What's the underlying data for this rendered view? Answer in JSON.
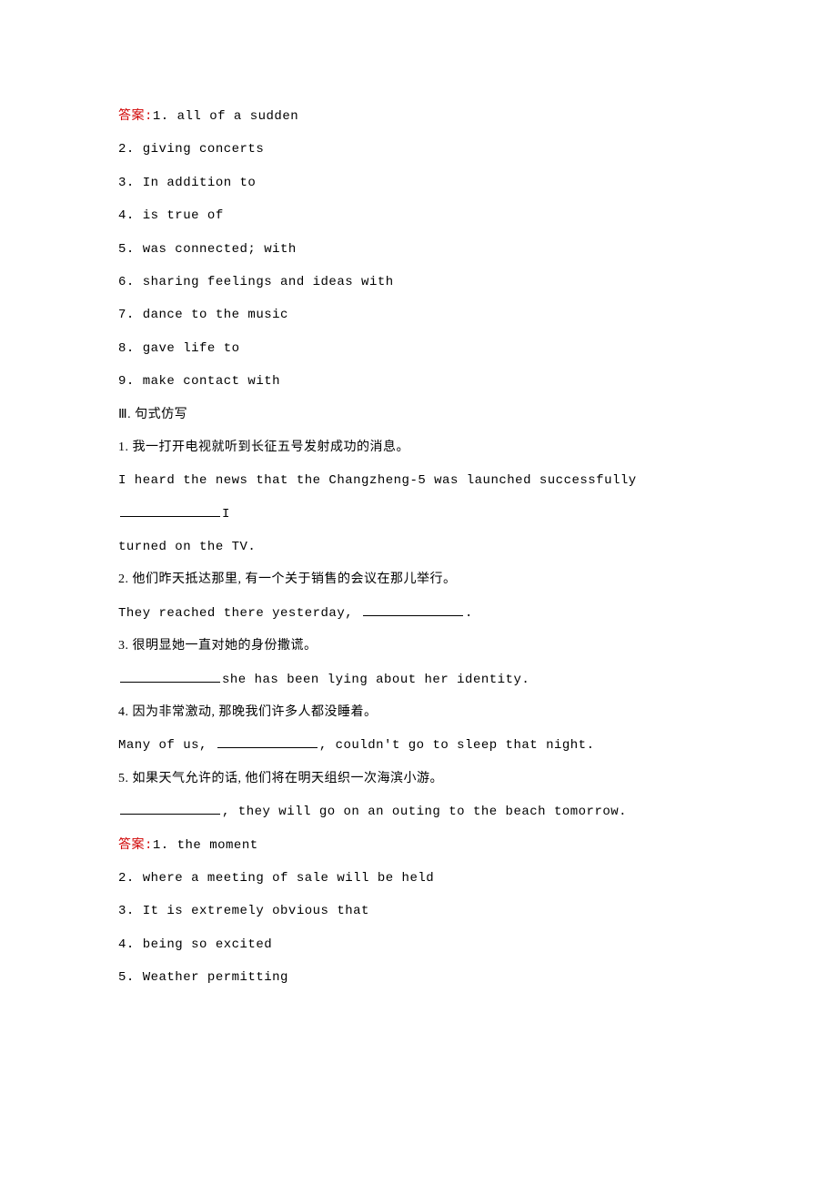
{
  "answers1_label": "答案:",
  "answers1": [
    "1. all of a sudden",
    "2. giving concerts",
    "3. In addition to",
    "4. is true of",
    "5. was connected; with",
    "6. sharing feelings and ideas with",
    "7. dance to the music",
    "8. gave life to",
    "9. make contact with"
  ],
  "section3_title": "Ⅲ. 句式仿写",
  "q1": {
    "cn": "1. 我一打开电视就听到长征五号发射成功的消息。",
    "en_before": "I heard the news that the Changzheng-5 was launched successfully",
    "en_after": "I",
    "en_line2": "turned on the TV."
  },
  "q2": {
    "cn": "2. 他们昨天抵达那里, 有一个关于销售的会议在那儿举行。",
    "en_before": "They reached there yesterday, ",
    "en_after": "."
  },
  "q3": {
    "cn": "3. 很明显她一直对她的身份撒谎。",
    "en_after": "she has been lying about her identity."
  },
  "q4": {
    "cn": "4. 因为非常激动, 那晚我们许多人都没睡着。",
    "en_before": "Many of us, ",
    "en_mid": ", couldn't go to sleep that night."
  },
  "q5": {
    "cn": "5. 如果天气允许的话, 他们将在明天组织一次海滨小游。",
    "en_after": ", they will go on an outing to the beach tomorrow."
  },
  "answers2_label": "答案:",
  "answers2": [
    "1. the moment",
    "2. where a meeting of sale will be held",
    "3. It is extremely obvious that",
    "4. being so excited",
    "5. Weather permitting"
  ]
}
